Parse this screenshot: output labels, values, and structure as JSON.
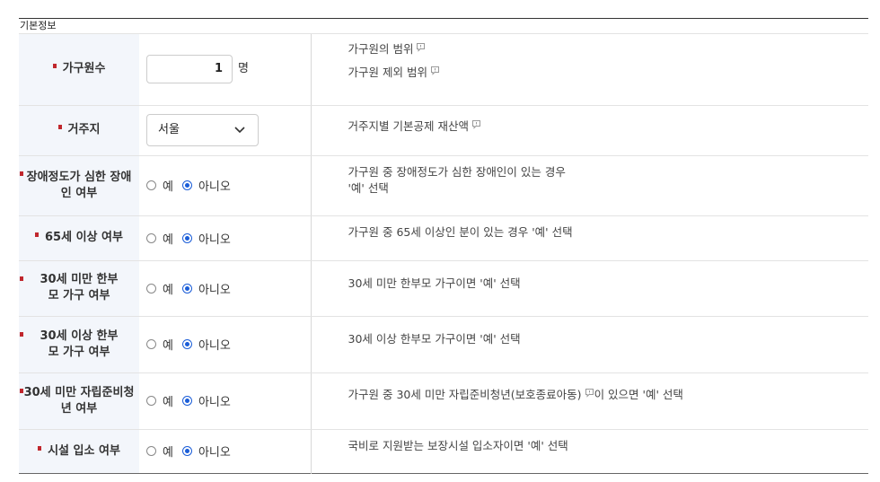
{
  "section_title": "기본정보",
  "rows": {
    "household": {
      "label": "가구원수",
      "value": "1",
      "unit": "명",
      "desc1": "가구원의 범위",
      "desc2": "가구원 제외 범위"
    },
    "residence": {
      "label": "거주지",
      "selected": "서울",
      "desc": "거주지별 기본공제 재산액"
    },
    "disability": {
      "label": "장애정도가 심한 장애인 여부",
      "yes": "예",
      "no": "아니오",
      "desc1": "가구원 중 장애정도가 심한 장애인이 있는 경우",
      "desc2": "'예' 선택"
    },
    "age65": {
      "label": "65세 이상 여부",
      "yes": "예",
      "no": "아니오",
      "desc": "가구원 중 65세 이상인 분이 있는 경우 '예' 선택"
    },
    "single_under30": {
      "label": "30세 미만 한부모 가구 여부",
      "yes": "예",
      "no": "아니오",
      "desc": "30세 미만 한부모 가구이면 '예' 선택"
    },
    "single_over30": {
      "label": "30세 이상 한부모 가구 여부",
      "yes": "예",
      "no": "아니오",
      "desc": "30세 이상 한부모 가구이면 '예' 선택"
    },
    "youth": {
      "label": "30세 미만 자립준비청년 여부",
      "yes": "예",
      "no": "아니오",
      "desc_a": "가구원 중 30세 미만 자립준비청년(보호종료아동)",
      "desc_b": "이 있으면 '예' 선택"
    },
    "facility": {
      "label": "시설 입소 여부",
      "yes": "예",
      "no": "아니오",
      "desc": "국비로 지원받는 보장시설 입소자이면 '예' 선택"
    }
  },
  "radio_state": "no",
  "colors": {
    "required_mark": "#c0272d",
    "radio_checked": "#1a5dd8",
    "label_bg": "#f3f6fb"
  },
  "icons": {
    "info": "info-speech-icon",
    "select": "chevron-down-icon"
  }
}
